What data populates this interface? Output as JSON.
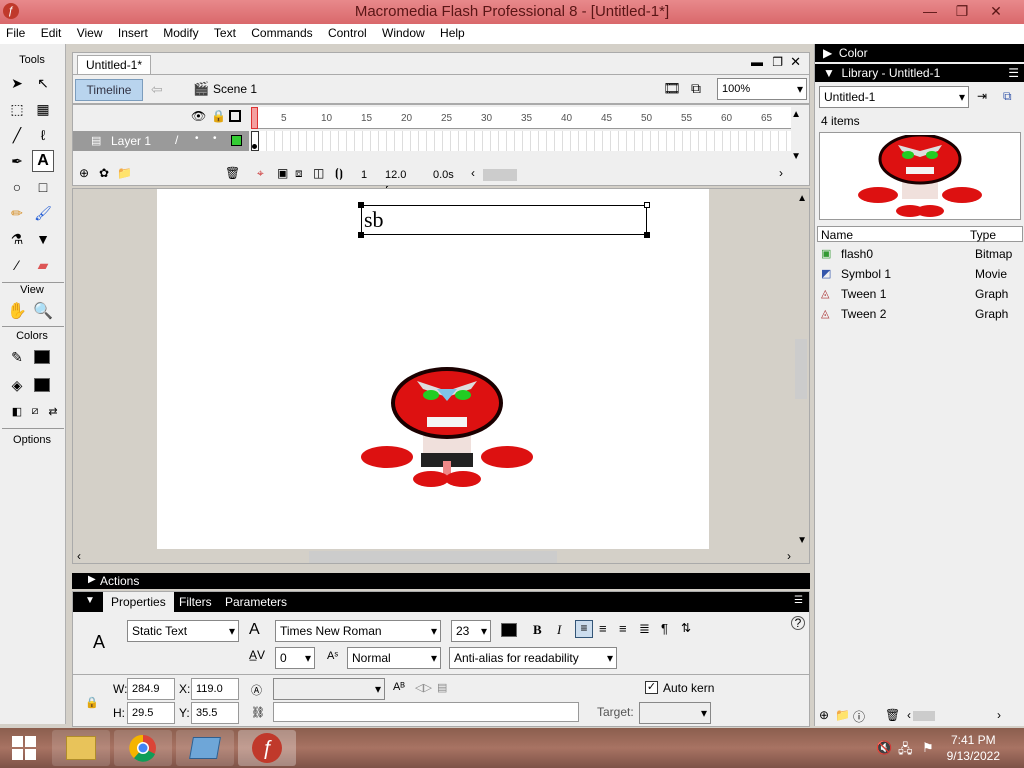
{
  "window": {
    "title": "Macromedia Flash Professional 8 - [Untitled-1*]"
  },
  "menu": [
    "File",
    "Edit",
    "View",
    "Insert",
    "Modify",
    "Text",
    "Commands",
    "Control",
    "Window",
    "Help"
  ],
  "tools": {
    "label": "Tools",
    "view_label": "View",
    "colors_label": "Colors",
    "options_label": "Options"
  },
  "document": {
    "tab": "Untitled-1*",
    "timeline_btn": "Timeline",
    "scene": "Scene 1",
    "zoom": "100%"
  },
  "timeline": {
    "layer_name": "Layer 1",
    "ruler": [
      "5",
      "10",
      "15",
      "20",
      "25",
      "30",
      "35",
      "40",
      "45",
      "50",
      "55",
      "60",
      "65"
    ],
    "current_frame": "1",
    "fps": "12.0 fps",
    "time": "0.0s"
  },
  "stage": {
    "text": "sb"
  },
  "panels": {
    "actions": "Actions",
    "tabs": [
      "Properties",
      "Filters",
      "Parameters"
    ]
  },
  "properties": {
    "text_type": "Static Text",
    "font": "Times New Roman",
    "font_size": "23",
    "letter_spacing": "0",
    "position": "Normal",
    "anti_alias": "Anti-alias for readability",
    "w_label": "W:",
    "w": "284.9",
    "h_label": "H:",
    "h": "29.5",
    "x_label": "X:",
    "x": "119.0",
    "y_label": "Y:",
    "y": "35.5",
    "auto_kern": "Auto kern",
    "target_label": "Target:"
  },
  "right": {
    "color_panel": "Color",
    "library_panel": "Library - Untitled-1",
    "library_select": "Untitled-1",
    "items_count": "4 items",
    "col_name": "Name",
    "col_type": "Type",
    "items": [
      {
        "name": "flash0",
        "type": "Bitmap"
      },
      {
        "name": "Symbol 1",
        "type": "Movie"
      },
      {
        "name": "Tween 1",
        "type": "Graph"
      },
      {
        "name": "Tween 2",
        "type": "Graph"
      }
    ]
  },
  "taskbar": {
    "time": "7:41 PM",
    "date": "9/13/2022"
  }
}
